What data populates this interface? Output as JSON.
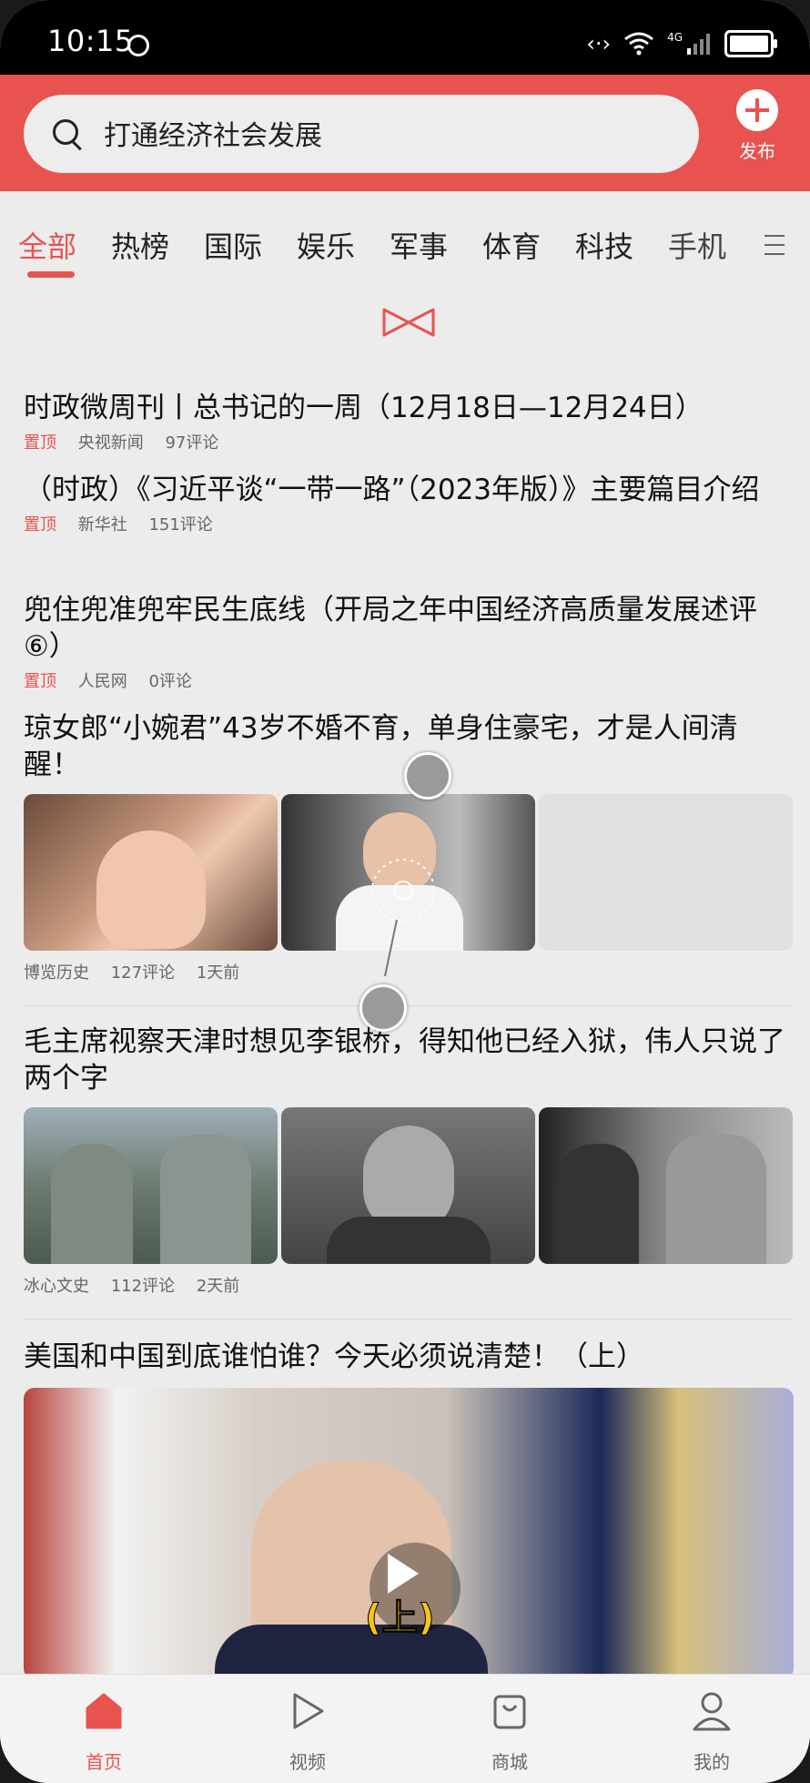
{
  "status_bar": {
    "time": "10:15",
    "network": "4G"
  },
  "search": {
    "query": "打通经济社会发展"
  },
  "header": {
    "publish_label": "发布"
  },
  "tabs": [
    "全部",
    "热榜",
    "国际",
    "娱乐",
    "军事",
    "体育",
    "科技",
    "手机"
  ],
  "articles": [
    {
      "title": "时政微周刊丨总书记的一周（12月18日—12月24日）",
      "pin": "置顶",
      "source": "央视新闻",
      "comments": "97评论"
    },
    {
      "title": "（时政）《习近平谈“一带一路”（2023年版）》主要篇目介绍",
      "pin": "置顶",
      "source": "新华社",
      "comments": "151评论"
    },
    {
      "title": "兜住兜准兜牢民生底线（开局之年中国经济高质量发展述评⑥）",
      "pin": "置顶",
      "source": "人民网",
      "comments": "0评论"
    },
    {
      "title": "琼女郎“小婉君”43岁不婚不育，单身住豪宅，才是人间清醒！",
      "source": "博览历史",
      "comments": "127评论",
      "time": "1天前"
    },
    {
      "title": "毛主席视察天津时想见李银桥，得知他已经入狱，伟人只说了两个字",
      "source": "冰心文史",
      "comments": "112评论",
      "time": "2天前"
    },
    {
      "title": "美国和中国到底谁怕谁？今天必须说清楚！（上）",
      "overlay_badge": "(上)"
    }
  ],
  "bottom_nav": [
    "首页",
    "视频",
    "商城",
    "我的"
  ]
}
